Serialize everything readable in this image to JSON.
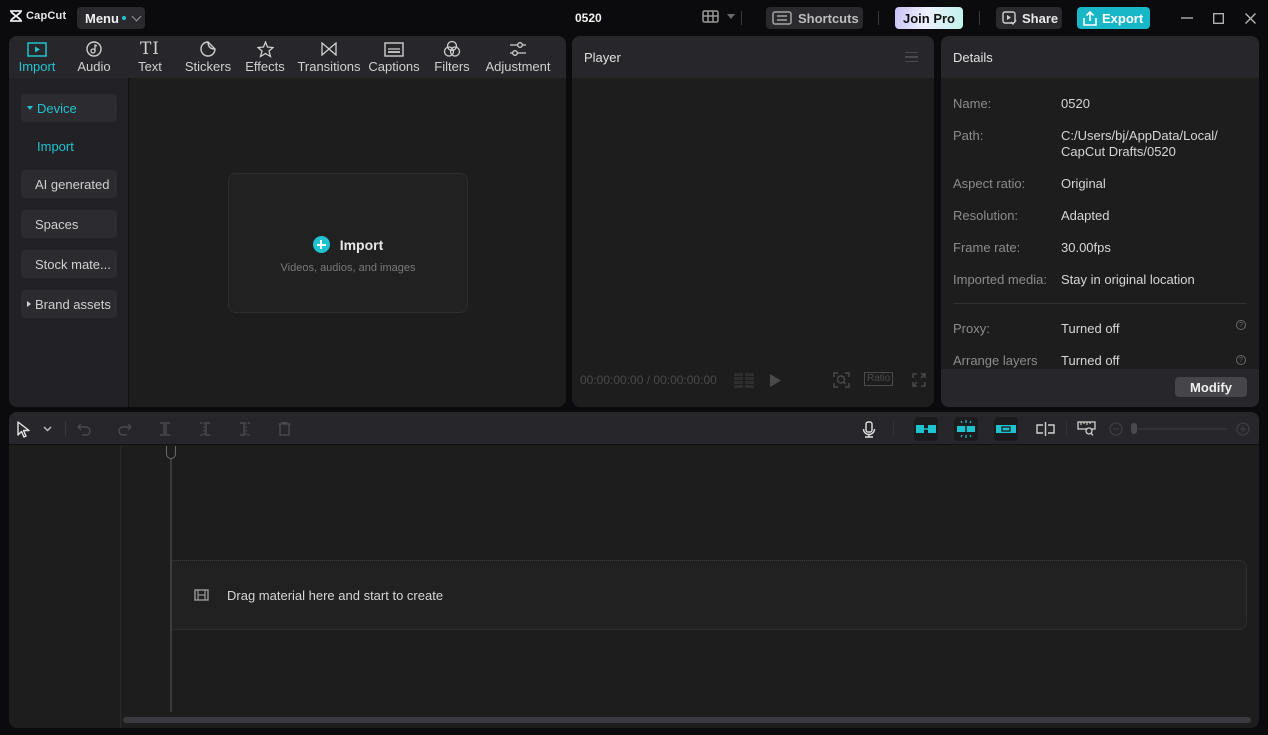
{
  "titlebar": {
    "logo_text": "CapCut",
    "menu_label": "Menu",
    "project_title": "0520",
    "shortcuts_label": "Shortcuts",
    "join_pro_label": "Join Pro",
    "share_label": "Share",
    "export_label": "Export",
    "accent_color": "#1fc3d0"
  },
  "media": {
    "tabs": [
      {
        "label": "Import",
        "icon": "import-icon",
        "active": true
      },
      {
        "label": "Audio",
        "icon": "audio-icon"
      },
      {
        "label": "Text",
        "icon": "text-icon"
      },
      {
        "label": "Stickers",
        "icon": "sticker-icon"
      },
      {
        "label": "Effects",
        "icon": "effects-icon"
      },
      {
        "label": "Transitions",
        "icon": "transitions-icon"
      },
      {
        "label": "Captions",
        "icon": "captions-icon"
      },
      {
        "label": "Filters",
        "icon": "filters-icon"
      },
      {
        "label": "Adjustment",
        "icon": "adjustment-icon"
      }
    ],
    "sidebar": {
      "device": "Device",
      "import": "Import",
      "ai_generated": "AI generated",
      "spaces": "Spaces",
      "stock": "Stock mate...",
      "brand_assets": "Brand assets"
    },
    "import_box": {
      "title": "Import",
      "subtitle": "Videos, audios, and images"
    }
  },
  "player": {
    "title": "Player",
    "timecode": "00:00:00:00 / 00:00:00:00",
    "ratio_label": "Ratio"
  },
  "details": {
    "title": "Details",
    "rows": [
      {
        "label": "Name:",
        "value": "0520"
      },
      {
        "label": "Path:",
        "value": "C:/Users/bj/AppData/Local/",
        "value2": "CapCut Drafts/0520"
      },
      {
        "label": "Aspect ratio:",
        "value": "Original"
      },
      {
        "label": "Resolution:",
        "value": "Adapted"
      },
      {
        "label": "Frame rate:",
        "value": "30.00fps"
      },
      {
        "label": "Imported media:",
        "value": "Stay in original location"
      },
      {
        "label": "Proxy:",
        "value": "Turned off"
      },
      {
        "label": "Arrange layers",
        "value": "Turned off"
      }
    ],
    "modify_label": "Modify"
  },
  "timeline": {
    "drop_text": "Drag material here and start to create"
  }
}
